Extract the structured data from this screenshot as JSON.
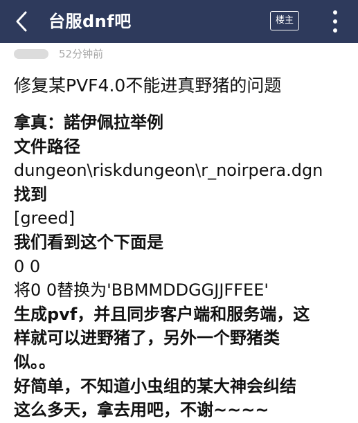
{
  "header": {
    "title": "台服dnf吧",
    "louzhu_label": "楼主",
    "colors": {
      "bar_bg": "#2e3a5c",
      "bar_text": "#ffffff"
    },
    "icons": [
      "back-arrow-icon",
      "more-vertical-icon"
    ]
  },
  "post": {
    "time": "52分钟前",
    "title": "修复某PVF4.0不能进真野猪的问题",
    "lines": [
      "拿真：諾伊佩拉举例",
      "文件路径",
      "dungeon\\riskdungeon\\r_noirpera.dgn",
      "找到",
      "[greed]",
      "我们看到这个下面是",
      "0 0",
      "将0 0替换为'BBMMDDGGJJFFEE'",
      "生成pvf，并且同步客户端和服务端，这",
      "样就可以进野猪了，另外一个野猪类",
      "似。。",
      "好简单，不知道小虫组的某大神会纠结",
      "这么多天，拿去用吧，不谢~~~~"
    ]
  }
}
